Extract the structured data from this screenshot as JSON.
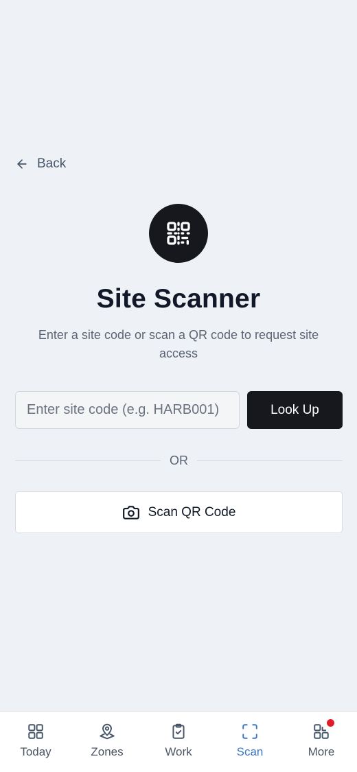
{
  "nav": {
    "back_label": "Back"
  },
  "header": {
    "title": "Site Scanner",
    "subtitle": "Enter a site code or scan a QR code to request site access"
  },
  "lookup": {
    "input_value": "",
    "input_placeholder": "Enter site code (e.g. HARB001)",
    "button_label": "Look Up"
  },
  "divider_label": "OR",
  "scan": {
    "button_label": "Scan QR Code"
  },
  "tabbar": {
    "items": [
      {
        "label": "Today",
        "icon": "grid-icon",
        "active": false
      },
      {
        "label": "Zones",
        "icon": "map-pin-icon",
        "active": false
      },
      {
        "label": "Work",
        "icon": "clipboard-check-icon",
        "active": false
      },
      {
        "label": "Scan",
        "icon": "scan-frame-icon",
        "active": true
      },
      {
        "label": "More",
        "icon": "apps-icon",
        "active": false,
        "has_notification": true
      }
    ]
  },
  "colors": {
    "background": "#eef1f6",
    "primary_dark": "#16181d",
    "active_tab": "#3b78c6",
    "notification": "#e11d2a"
  }
}
